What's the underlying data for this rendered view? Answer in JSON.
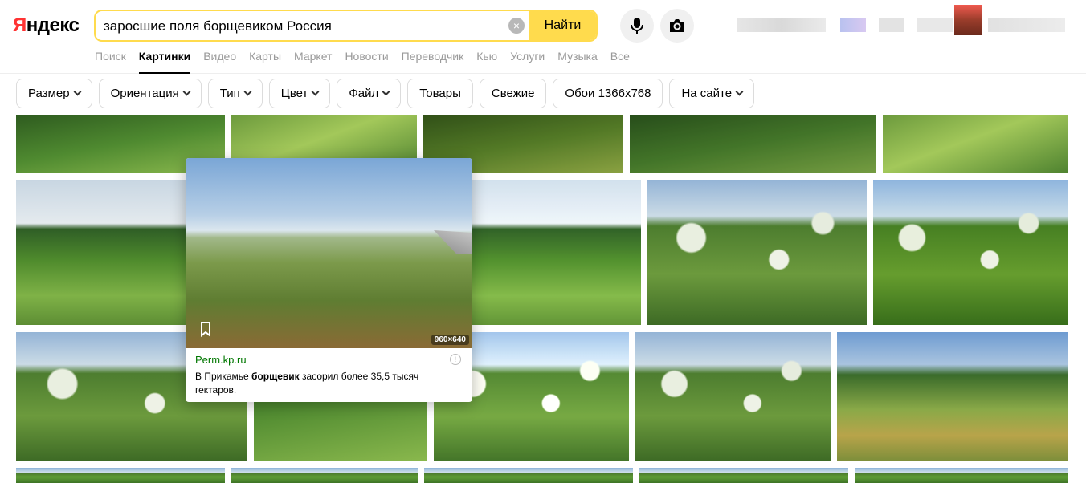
{
  "logo": {
    "first": "Я",
    "rest": "ндекс"
  },
  "search": {
    "query": "заросшие поля борщевиком Россия",
    "clear": "×",
    "button": "Найти"
  },
  "nav": [
    "Поиск",
    "Картинки",
    "Видео",
    "Карты",
    "Маркет",
    "Новости",
    "Переводчик",
    "Кью",
    "Услуги",
    "Музыка",
    "Все"
  ],
  "nav_active": "Картинки",
  "filters": [
    {
      "label": "Размер",
      "dropdown": true
    },
    {
      "label": "Ориентация",
      "dropdown": true
    },
    {
      "label": "Тип",
      "dropdown": true
    },
    {
      "label": "Цвет",
      "dropdown": true
    },
    {
      "label": "Файл",
      "dropdown": true
    },
    {
      "label": "Товары",
      "dropdown": false
    },
    {
      "label": "Свежие",
      "dropdown": false
    },
    {
      "label": "Обои 1366x768",
      "dropdown": false
    },
    {
      "label": "На сайте",
      "dropdown": true
    }
  ],
  "preview": {
    "size": "960×640",
    "source": "Perm.kp.ru",
    "desc_pre": "В Прикамье ",
    "desc_bold": "борщевик",
    "desc_post": " засорил более 35,5 тысяч гектаров."
  },
  "colors": {
    "accent": "#ffdb4d",
    "source_green": "#007700",
    "logo_red": "#ff3333"
  }
}
